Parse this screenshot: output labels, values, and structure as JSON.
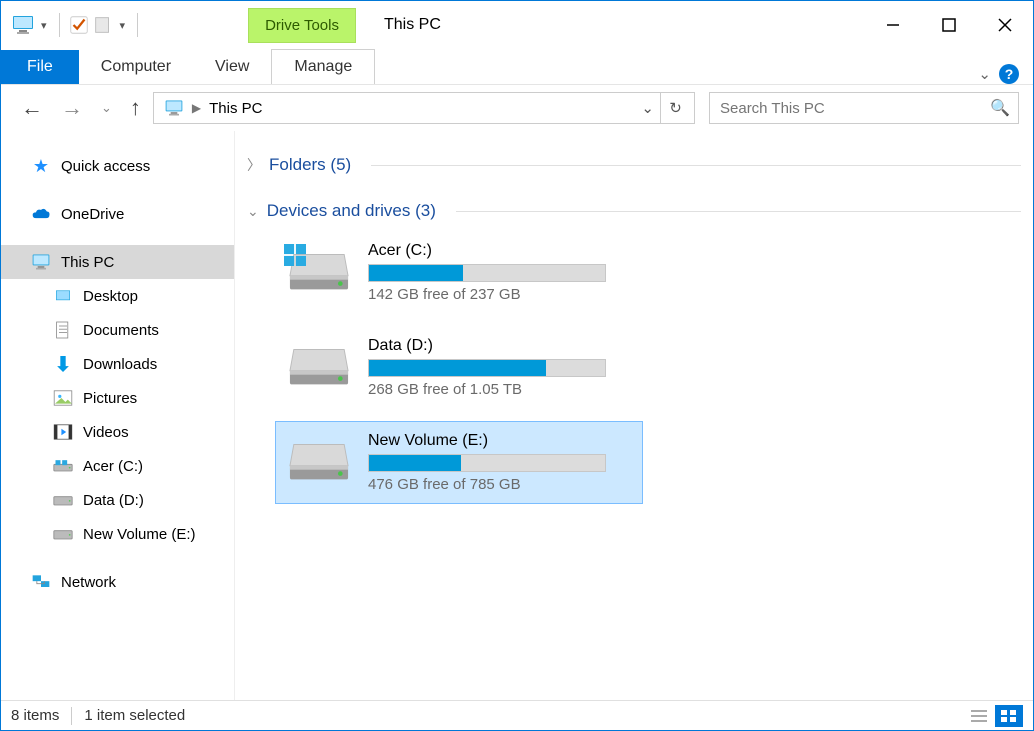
{
  "titlebar": {
    "drive_tools_label": "Drive Tools",
    "title": "This PC"
  },
  "ribbon": {
    "file": "File",
    "computer": "Computer",
    "view": "View",
    "manage": "Manage"
  },
  "address": {
    "location": "This PC"
  },
  "search": {
    "placeholder": "Search This PC"
  },
  "sidebar": {
    "quick_access": "Quick access",
    "onedrive": "OneDrive",
    "this_pc": "This PC",
    "desktop": "Desktop",
    "documents": "Documents",
    "downloads": "Downloads",
    "pictures": "Pictures",
    "videos": "Videos",
    "acer_c": "Acer (C:)",
    "data_d": "Data (D:)",
    "newvol_e": "New Volume (E:)",
    "network": "Network"
  },
  "groups": {
    "folders_label": "Folders (5)",
    "drives_label": "Devices and drives (3)"
  },
  "drives": [
    {
      "key": "c",
      "name": "Acer (C:)",
      "free": "142 GB free of 237 GB",
      "fill_pct": 40,
      "win_badge": true,
      "selected": false
    },
    {
      "key": "d",
      "name": "Data (D:)",
      "free": "268 GB free of 1.05 TB",
      "fill_pct": 75,
      "win_badge": false,
      "selected": false
    },
    {
      "key": "e",
      "name": "New Volume (E:)",
      "free": "476 GB free of 785 GB",
      "fill_pct": 39,
      "win_badge": false,
      "selected": true
    }
  ],
  "status": {
    "items": "8 items",
    "selected": "1 item selected"
  }
}
